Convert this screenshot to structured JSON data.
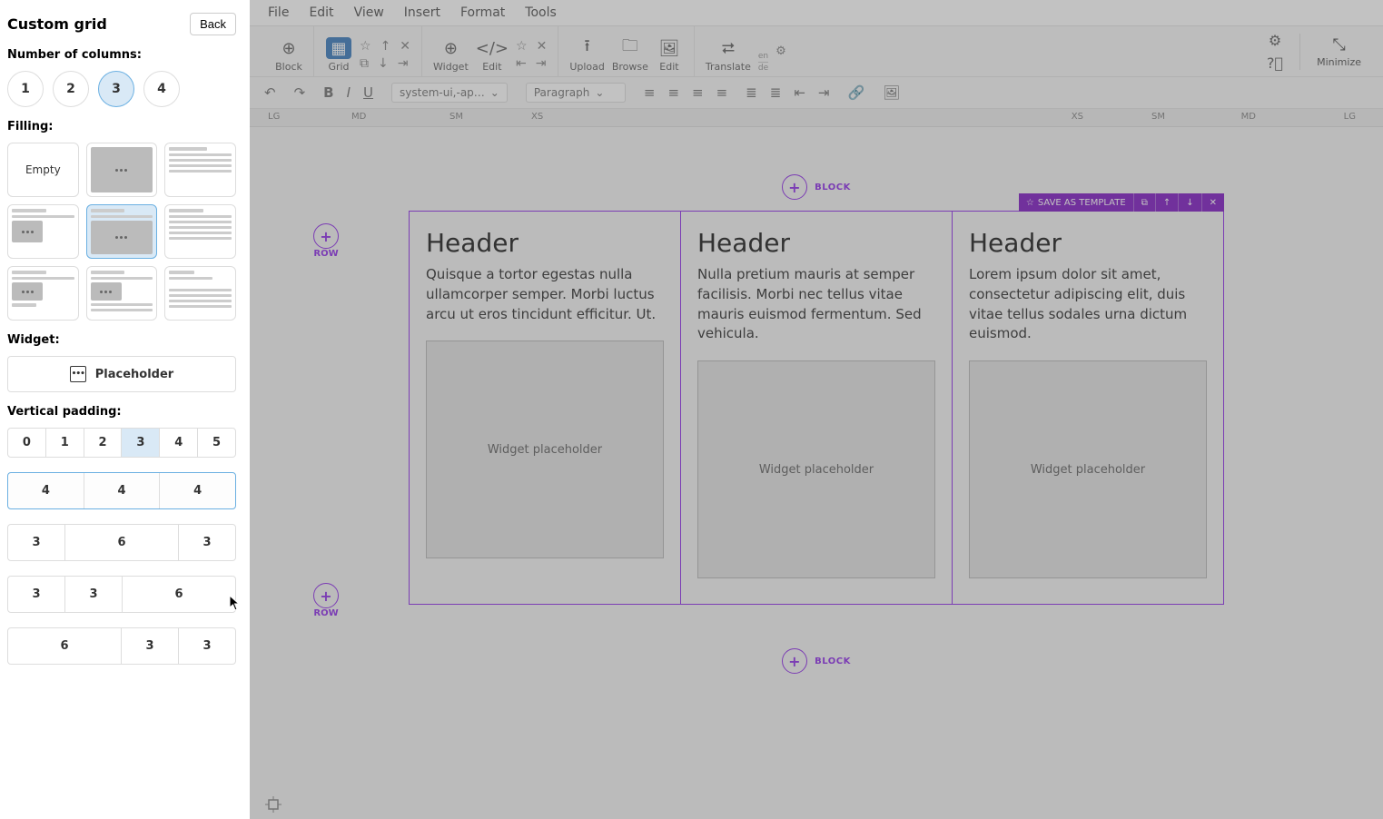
{
  "sidebar": {
    "title": "Custom grid",
    "back_label": "Back",
    "sections": {
      "columns_label": "Number of columns:",
      "filling_label": "Filling:",
      "widget_label": "Widget:",
      "padding_label": "Vertical padding:"
    },
    "column_options": [
      "1",
      "2",
      "3",
      "4"
    ],
    "column_selected": "3",
    "filling_empty_label": "Empty",
    "filling_selected_index": 4,
    "widget_name": "Placeholder",
    "padding_options": [
      "0",
      "1",
      "2",
      "3",
      "4",
      "5"
    ],
    "padding_selected": "3",
    "layouts": [
      {
        "cells": [
          "4",
          "4",
          "4"
        ],
        "selected": true
      },
      {
        "cells": [
          "3",
          "6",
          "3"
        ],
        "selected": false
      },
      {
        "cells": [
          "3",
          "3",
          "6"
        ],
        "selected": false
      },
      {
        "cells": [
          "6",
          "3",
          "3"
        ],
        "selected": false
      }
    ]
  },
  "menubar": [
    "File",
    "Edit",
    "View",
    "Insert",
    "Format",
    "Tools"
  ],
  "toolbar": {
    "block": "Block",
    "grid": "Grid",
    "widget": "Widget",
    "edit": "Edit",
    "upload": "Upload",
    "browse": "Browse",
    "edit2": "Edit",
    "translate": "Translate",
    "minimize": "Minimize",
    "lang1": "en",
    "lang2": "de"
  },
  "formatbar": {
    "font": "system-ui,-ap…",
    "style": "Paragraph"
  },
  "breakpoints_left": [
    "LG",
    "MD",
    "SM",
    "XS"
  ],
  "breakpoints_right": [
    "XS",
    "SM",
    "MD",
    "LG"
  ],
  "canvas": {
    "block_label": "BLOCK",
    "row_label": "ROW",
    "save_template": "SAVE AS TEMPLATE",
    "columns": [
      {
        "header": "Header",
        "text": "Quisque a tortor egestas nulla ullamcorper semper. Morbi luctus arcu ut eros tincidunt efficitur. Ut.",
        "placeholder": "Widget placeholder"
      },
      {
        "header": "Header",
        "text": "Nulla pretium mauris at semper facilisis. Morbi nec tellus vitae mauris euismod fermentum. Sed vehicula.",
        "placeholder": "Widget placeholder"
      },
      {
        "header": "Header",
        "text": "Lorem ipsum dolor sit amet, consectetur adipiscing elit, duis vitae tellus sodales urna dictum euismod.",
        "placeholder": "Widget placeholder"
      }
    ]
  },
  "colors": {
    "accent": "#9333ea",
    "toolbar_selected": "#3f7fbf",
    "panel_selected": "#d9e9f6"
  }
}
